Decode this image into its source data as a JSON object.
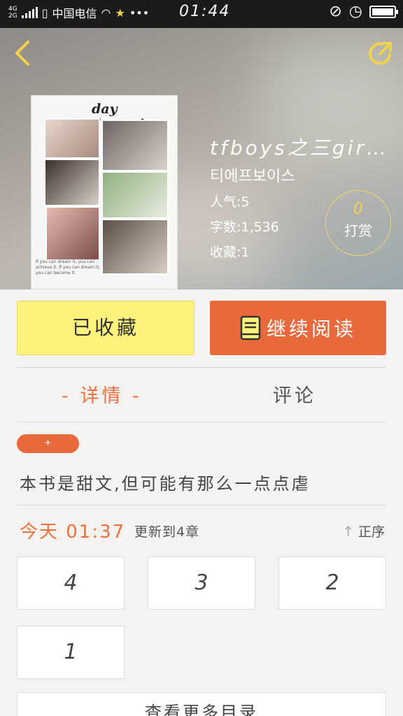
{
  "status_bar": {
    "network_top": "4G",
    "network_bottom": "2G",
    "carrier": "中国电信",
    "time": "01:44"
  },
  "book": {
    "cover_title": "day dreaming",
    "cover_quote": "If you can dream it, you can achieve it. If you can dream it, you can become it.",
    "title": "tfboys之三gir…",
    "author": "티에프보이스",
    "popularity_label": "人气:",
    "popularity_value": "5",
    "words_label": "字数:",
    "words_value": "1,536",
    "favorites_label": "收藏:",
    "favorites_value": "1",
    "reward_count": "0",
    "reward_label": "打赏"
  },
  "actions": {
    "collected_label": "已收藏",
    "continue_label": "继续阅读"
  },
  "tabs": {
    "detail": "- 详情 -",
    "comment": "评论"
  },
  "detail": {
    "tag": "+",
    "summary": "本书是甜文,但可能有那么一点点虐"
  },
  "update": {
    "date": "今天 01:37",
    "text": "更新到4章",
    "sort_label": "正序"
  },
  "chapters": [
    "4",
    "3",
    "2",
    "1"
  ],
  "catalog_label": "查看更多目录",
  "colors": {
    "accent": "#e8693c",
    "collect_yellow": "#fdf27c",
    "icon_yellow": "#f2d24b"
  }
}
